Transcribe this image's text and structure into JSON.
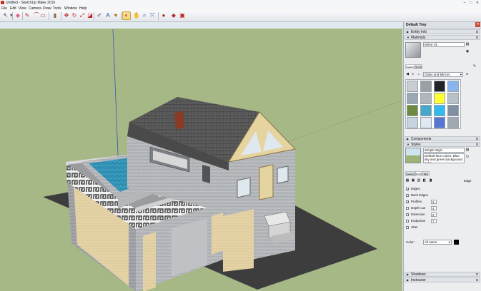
{
  "window": {
    "title": "Untitled - SketchUp Make 2016",
    "minimize": "–",
    "maximize": "□",
    "close": "✕"
  },
  "menu": [
    {
      "label": "File"
    },
    {
      "label": "Edit"
    },
    {
      "label": "View"
    },
    {
      "label": "Camera"
    },
    {
      "label": "Draw"
    },
    {
      "label": "Tools"
    },
    {
      "label": "Window"
    },
    {
      "label": "Help"
    }
  ],
  "toolbar": [
    {
      "name": "select-tool-button",
      "icon": "arrow-cursor-icon",
      "glyph": "↖",
      "color": "#333333"
    },
    {
      "name": "dropdown-arrow-button",
      "icon": "chevron-down-icon",
      "glyph": "▾",
      "color": "#555555"
    },
    {
      "name": "eraser-tool-button",
      "icon": "eraser-icon",
      "glyph": "◆",
      "color": "#e0608a"
    },
    {
      "name": "line-tool-button",
      "icon": "pencil-icon",
      "glyph": "✎",
      "color": "#b02020"
    },
    {
      "name": "arc-tool-button",
      "icon": "arc-icon",
      "glyph": "⌒",
      "color": "#c03030"
    },
    {
      "name": "shape-tool-button",
      "icon": "rectangle-icon",
      "glyph": "▭",
      "color": "#c03030"
    },
    {
      "name": "pushpull-tool-button",
      "icon": "push-pull-icon",
      "glyph": "▮",
      "color": "#8a6a40"
    },
    {
      "name": "move-tool-button",
      "icon": "move-icon",
      "glyph": "✥",
      "color": "#c02020"
    },
    {
      "name": "rotate-tool-button",
      "icon": "rotate-icon",
      "glyph": "↻",
      "color": "#c02020"
    },
    {
      "name": "scale-tool-button",
      "icon": "scale-icon",
      "glyph": "⤢",
      "color": "#c02020"
    },
    {
      "name": "offset-tool-button",
      "icon": "offset-icon",
      "glyph": "◪",
      "color": "#c02020"
    },
    {
      "name": "tape-measure-button",
      "icon": "tape-measure-icon",
      "glyph": "✐",
      "color": "#666666"
    },
    {
      "name": "text-tool-button",
      "icon": "text-icon",
      "glyph": "A",
      "color": "#2050b0"
    },
    {
      "name": "paint-bucket-button",
      "icon": "paint-bucket-icon",
      "glyph": "♥",
      "color": "#b07020"
    },
    {
      "name": "orbit-tool-button",
      "icon": "orbit-icon",
      "glyph": "◐",
      "color": "#c02020"
    },
    {
      "name": "pan-tool-button",
      "icon": "hand-icon",
      "glyph": "✋",
      "color": "#8a6a40"
    },
    {
      "name": "zoom-tool-button",
      "icon": "magnifier-icon",
      "glyph": "⌕",
      "color": "#2050b0"
    },
    {
      "name": "zoom-extents-button",
      "icon": "zoom-extents-icon",
      "glyph": "⤧",
      "color": "#2050b0"
    },
    {
      "name": "warehouse-button",
      "icon": "warehouse-icon",
      "glyph": "●",
      "color": "#c02020"
    },
    {
      "name": "extension-button",
      "icon": "extension-icon",
      "glyph": "◆",
      "color": "#b03030"
    },
    {
      "name": "extension-warehouse-button",
      "icon": "extension-warehouse-icon",
      "glyph": "▣",
      "color": "#c02020"
    }
  ],
  "tray": {
    "title": "Default Tray",
    "close_glyph": "✕",
    "entity_info": "Entity Info",
    "materials": {
      "title": "Materials",
      "current_name": "Mirror 01",
      "tab_select": "Select",
      "tab_edit": "Edit",
      "library": "Glass and Mirrors",
      "swatches": [
        "#c9ccd0",
        "#9aa0a6",
        "#1f2226",
        "#8ab4ee",
        "#9aa8b4",
        "#b0b6bc",
        "#ffff33",
        "#b8c0c8",
        "#6e8a3e",
        "#46a9cc",
        "#33bbf0",
        "#8090a0",
        "#c8d4e0",
        "#dfe9f3",
        "#5576d2",
        "#a0a8b0"
      ]
    },
    "components": "Components",
    "styles": {
      "title": "Styles",
      "style_name": "Simple Style",
      "description": "Default face colors. Blue sky and green background color.",
      "tab_select": "Select",
      "tab_edit": "Edit",
      "tab_mix": "Mix",
      "edge_label": "Edge",
      "options": [
        {
          "label": "Edges",
          "checked": true,
          "value": ""
        },
        {
          "label": "Back Edges",
          "checked": false,
          "value": ""
        },
        {
          "label": "Profiles",
          "checked": true,
          "value": "2"
        },
        {
          "label": "Depth cue",
          "checked": false,
          "value": "4"
        },
        {
          "label": "Extension",
          "checked": false,
          "value": "2"
        },
        {
          "label": "Endpoints",
          "checked": false,
          "value": "7"
        },
        {
          "label": "Jitter",
          "checked": false,
          "value": ""
        }
      ],
      "color_label": "Color:",
      "color_value": "All same"
    },
    "shadows": "Shadows",
    "instructor": "Instructor"
  }
}
